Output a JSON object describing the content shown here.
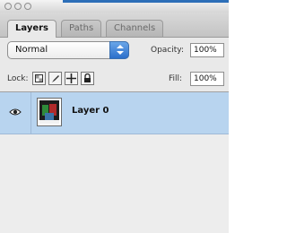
{
  "window": {
    "controls": [
      "close",
      "minimize",
      "zoom"
    ]
  },
  "tabs": [
    {
      "label": "Layers",
      "active": true
    },
    {
      "label": "Paths",
      "active": false
    },
    {
      "label": "Channels",
      "active": false
    }
  ],
  "blend_mode": {
    "value": "Normal"
  },
  "opacity": {
    "label": "Opacity:",
    "value": "100%"
  },
  "lock": {
    "label": "Lock:",
    "icons": [
      "lock-transparent-pixels-icon",
      "lock-image-pixels-icon",
      "lock-position-icon",
      "lock-all-icon"
    ]
  },
  "fill": {
    "label": "Fill:",
    "value": "100%"
  },
  "layers": [
    {
      "name": "Layer 0",
      "visible": true,
      "selected": true
    }
  ],
  "colors": {
    "selection": "#b8d4ef",
    "panel": "#e9e9e9",
    "accent": "#2b6fcb"
  }
}
